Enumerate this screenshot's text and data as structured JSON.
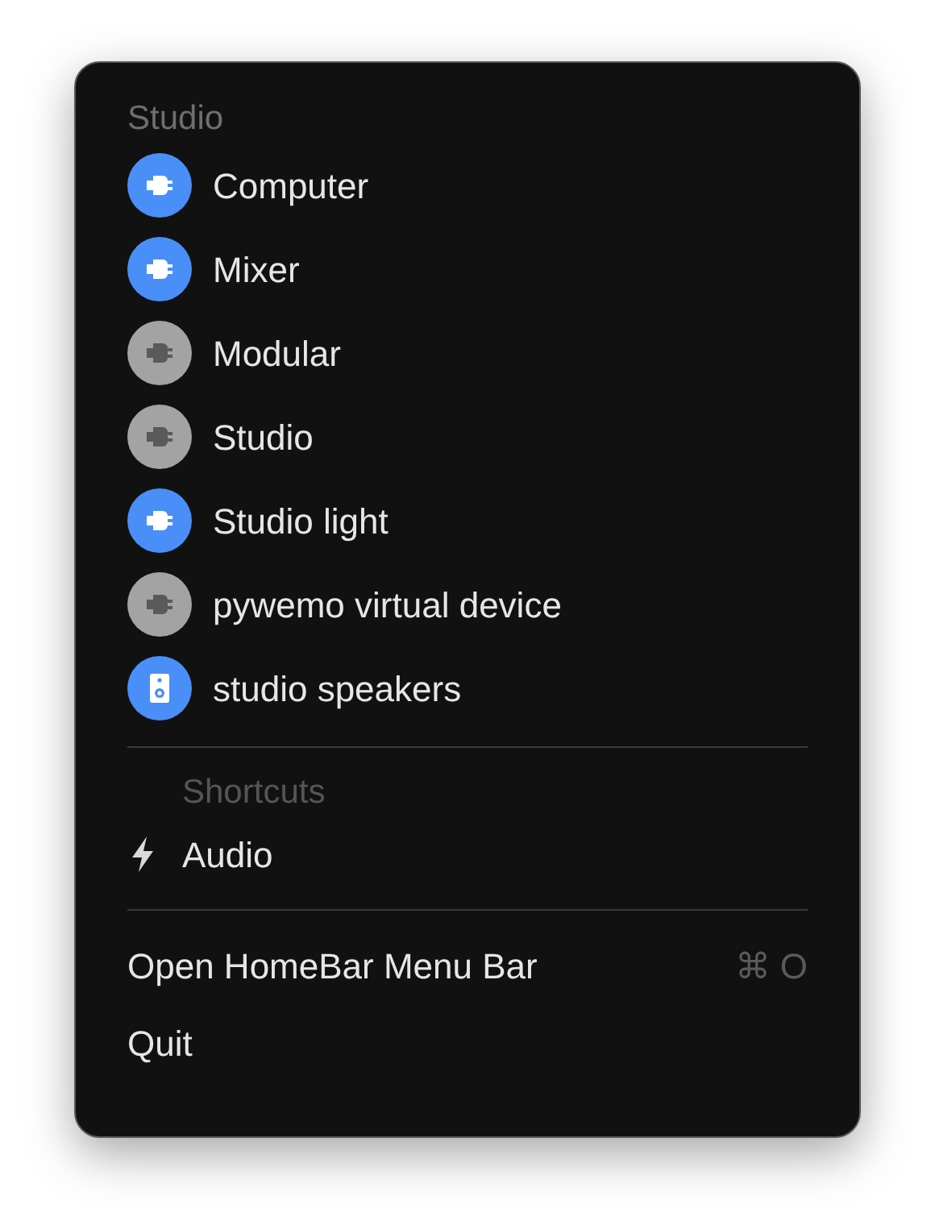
{
  "section_title": "Studio",
  "devices": [
    {
      "name": "Computer",
      "kind": "plug",
      "on": true
    },
    {
      "name": "Mixer",
      "kind": "plug",
      "on": true
    },
    {
      "name": "Modular",
      "kind": "plug",
      "on": false
    },
    {
      "name": "Studio",
      "kind": "plug",
      "on": false
    },
    {
      "name": "Studio light",
      "kind": "plug",
      "on": true
    },
    {
      "name": "pywemo virtual device",
      "kind": "plug",
      "on": false
    },
    {
      "name": "studio speakers",
      "kind": "speaker",
      "on": true
    }
  ],
  "shortcuts_title": "Shortcuts",
  "shortcuts": [
    {
      "name": "Audio"
    }
  ],
  "actions": [
    {
      "label": "Open HomeBar Menu Bar",
      "shortcut": "⌘ O"
    },
    {
      "label": "Quit"
    }
  ]
}
